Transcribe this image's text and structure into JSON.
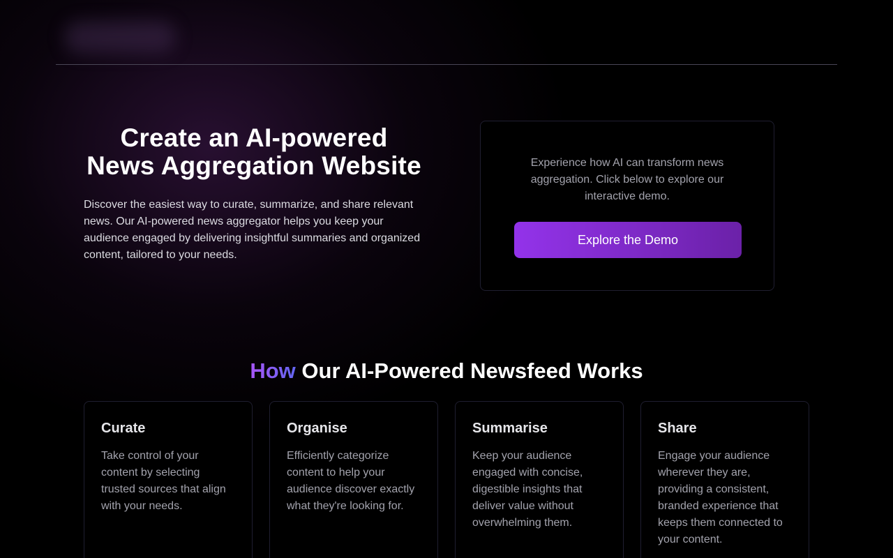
{
  "hero": {
    "title": "Create an AI-powered News Aggregation Website",
    "description": "Discover the easiest way to curate, summarize, and share relevant news. Our AI-powered news aggregator helps you keep your audience engaged by delivering insightful summaries and organized content, tailored to your needs."
  },
  "demo": {
    "text": "Experience how AI can transform news aggregation. Click below to explore our interactive demo.",
    "button_label": "Explore the Demo",
    "button_gradient": [
      "#9333ea",
      "#6b21a8"
    ]
  },
  "how": {
    "title_accent": "How",
    "title_rest": " Our AI-Powered Newsfeed Works",
    "accent_gradient": [
      "#a855f7",
      "#6366f1"
    ],
    "cards": [
      {
        "title": "Curate",
        "description": "Take control of your content by selecting trusted sources that align with your needs."
      },
      {
        "title": "Organise",
        "description": "Efficiently categorize content to help your audience discover exactly what they're looking for."
      },
      {
        "title": "Summarise",
        "description": "Keep your audience engaged with concise, digestible insights that deliver value without overwhelming them."
      },
      {
        "title": "Share",
        "description": "Engage your audience wherever they are, providing a consistent, branded experience that keeps them connected to your content."
      }
    ]
  },
  "colors": {
    "background": "#000000",
    "card_border": "#1f1e30",
    "muted_text": "#a3a3ad"
  }
}
